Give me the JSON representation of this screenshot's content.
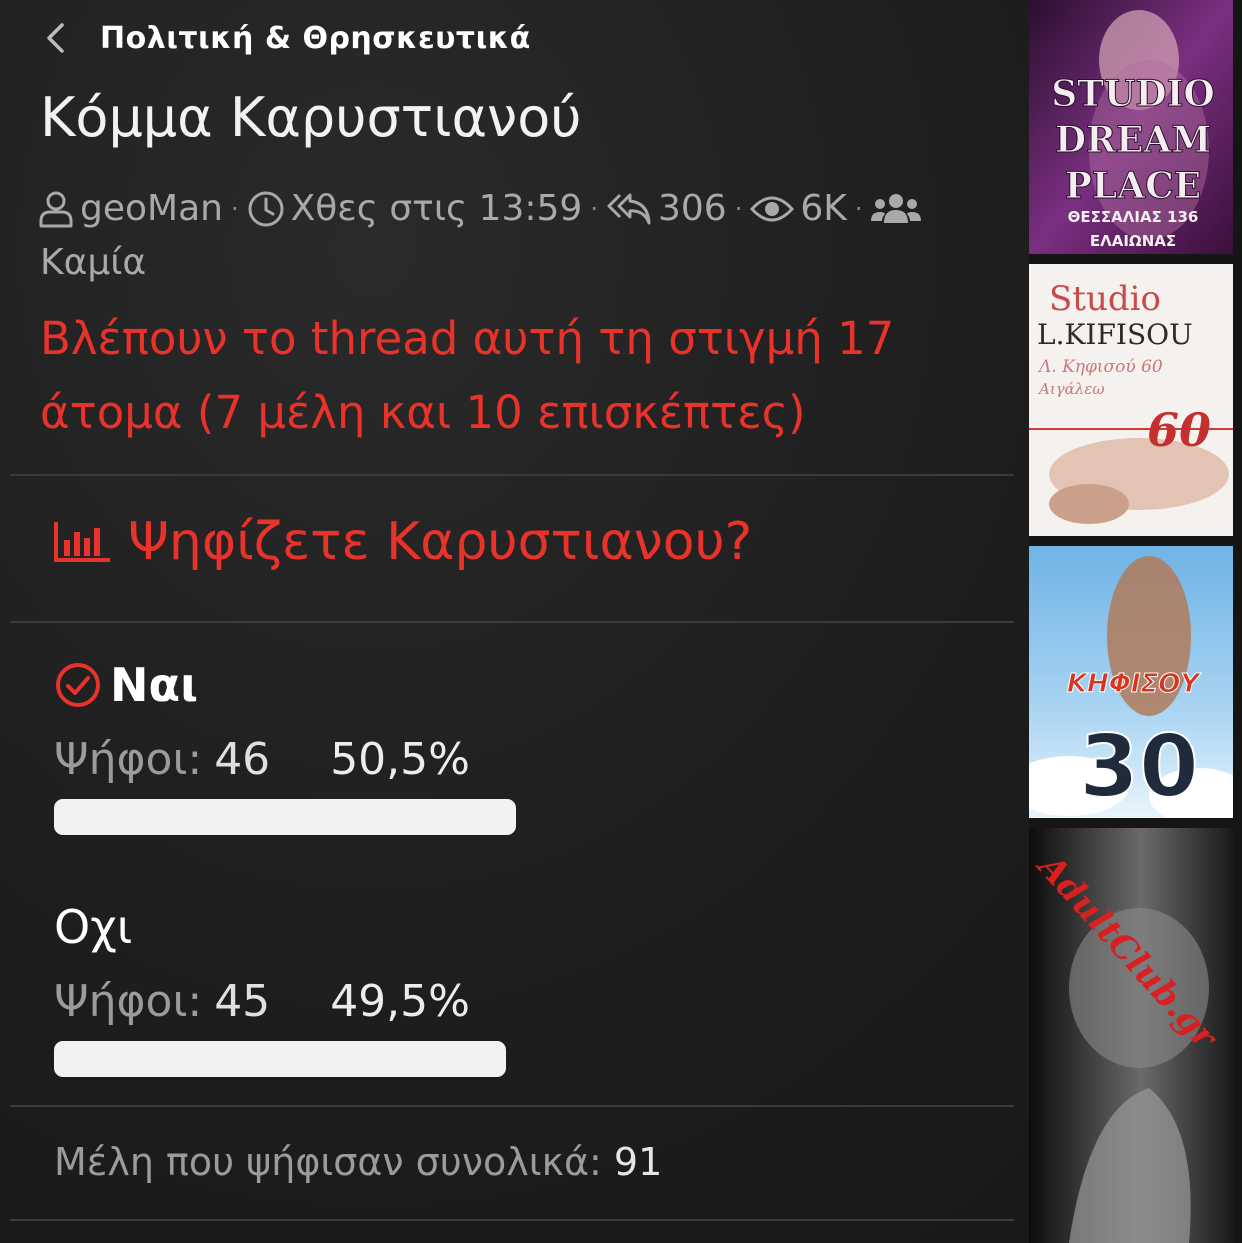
{
  "header": {
    "breadcrumb": "Πολιτική & Θρησκευτικά",
    "title": "Κόμμα Καρυστιανού"
  },
  "meta": {
    "author": "geoMan",
    "time": "Χθες στις 13:59",
    "replies": "306",
    "views": "6K",
    "participants": "Καμία"
  },
  "viewers_notice": "Βλέπουν το thread αυτή τη στιγμή 17 άτομα (7 μέλη και 10 επισκέπτες)",
  "poll": {
    "question": "Ψηφίζετε Καρυστιανου?",
    "votes_label": "Ψήφοι:",
    "options": [
      {
        "label": "Ναι",
        "votes": "46",
        "percent": "50,5%",
        "share": 0.505,
        "selected": true
      },
      {
        "label": "Οχι",
        "votes": "45",
        "percent": "49,5%",
        "share": 0.495,
        "selected": false
      }
    ],
    "total_label": "Μέλη που ψήφισαν συνολικά:",
    "total_value": "91"
  },
  "ads": [
    {
      "lines": [
        "STUDIO",
        "DREAM",
        "PLACE",
        "ΘΕΣΣΑΛΙΑΣ 136",
        "ΕΛΑΙΩΝΑΣ"
      ]
    },
    {
      "lines": [
        "Studio",
        "L.KIFISOU",
        "Λ. Κηφισού 60",
        "Αιγάλεω",
        "60"
      ]
    },
    {
      "lines": [
        "ΚΗΦΙΣΟΥ",
        "30"
      ]
    },
    {
      "lines": [
        "AdultClub.gr"
      ]
    }
  ],
  "colors": {
    "accent": "#e8322a",
    "background": "#1f1f1f",
    "muted_text": "#a9a9a9",
    "bar": "#f2f2f2"
  }
}
